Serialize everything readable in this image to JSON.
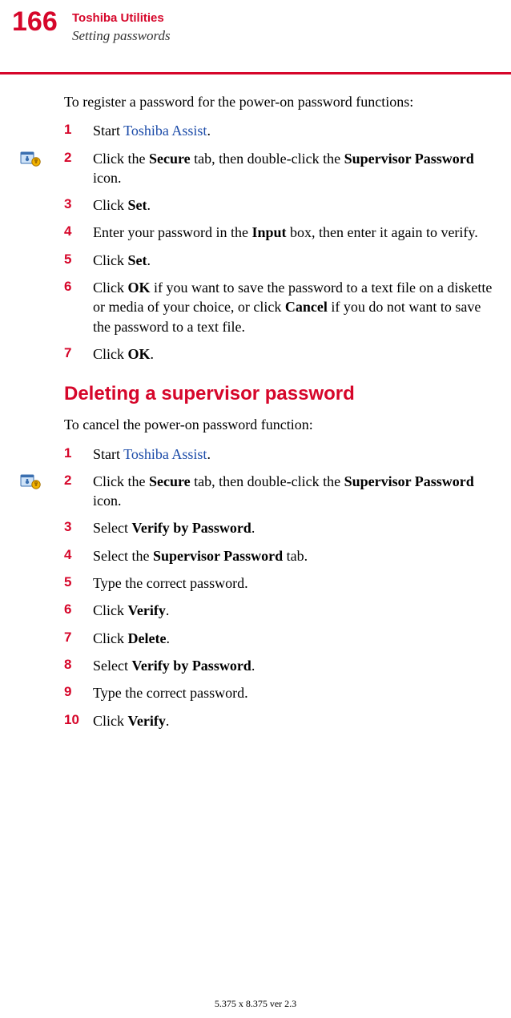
{
  "header": {
    "page_number": "166",
    "title": "Toshiba Utilities",
    "subtitle": "Setting passwords"
  },
  "intro": "To register a password for the power-on password functions:",
  "steps_a": [
    {
      "n": "1",
      "pre": "Start ",
      "link": "Toshiba Assist",
      "post": "."
    },
    {
      "n": "2",
      "pre": "Click the ",
      "b1": "Secure",
      "mid1": " tab, then double-click the ",
      "b2": "Supervisor Password",
      "post": " icon.",
      "icon": true
    },
    {
      "n": "3",
      "pre": "Click ",
      "b1": "Set",
      "post": "."
    },
    {
      "n": "4",
      "pre": "Enter your password in the ",
      "b1": "Input",
      "post": " box, then enter it again to verify."
    },
    {
      "n": "5",
      "pre": "Click ",
      "b1": "Set",
      "post": "."
    },
    {
      "n": "6",
      "pre": "Click ",
      "b1": "OK",
      "mid1": " if you want to save the password to a text file on a diskette or media of your choice, or click ",
      "b2": "Cancel",
      "post": " if you do not want to save the password to a text file."
    },
    {
      "n": "7",
      "pre": "Click ",
      "b1": "OK",
      "post": "."
    }
  ],
  "section_heading": "Deleting a supervisor password",
  "intro2": "To cancel the power-on password function:",
  "steps_b": [
    {
      "n": "1",
      "pre": "Start ",
      "link": "Toshiba Assist",
      "post": "."
    },
    {
      "n": "2",
      "pre": "Click the ",
      "b1": "Secure",
      "mid1": " tab, then double-click the ",
      "b2": "Supervisor Password",
      "post": " icon.",
      "icon": true
    },
    {
      "n": "3",
      "pre": "Select ",
      "b1": "Verify by Password",
      "post": "."
    },
    {
      "n": "4",
      "pre": "Select the ",
      "b1": "Supervisor Password",
      "post": " tab."
    },
    {
      "n": "5",
      "pre": "Type the correct password."
    },
    {
      "n": "6",
      "pre": "Click ",
      "b1": "Verify",
      "post": "."
    },
    {
      "n": "7",
      "pre": "Click ",
      "b1": "Delete",
      "post": "."
    },
    {
      "n": "8",
      "pre": "Select ",
      "b1": "Verify by Password",
      "post": "."
    },
    {
      "n": "9",
      "pre": "Type the correct password."
    },
    {
      "n": "10",
      "pre": "Click ",
      "b1": "Verify",
      "post": "."
    }
  ],
  "footer": "5.375 x 8.375 ver 2.3"
}
